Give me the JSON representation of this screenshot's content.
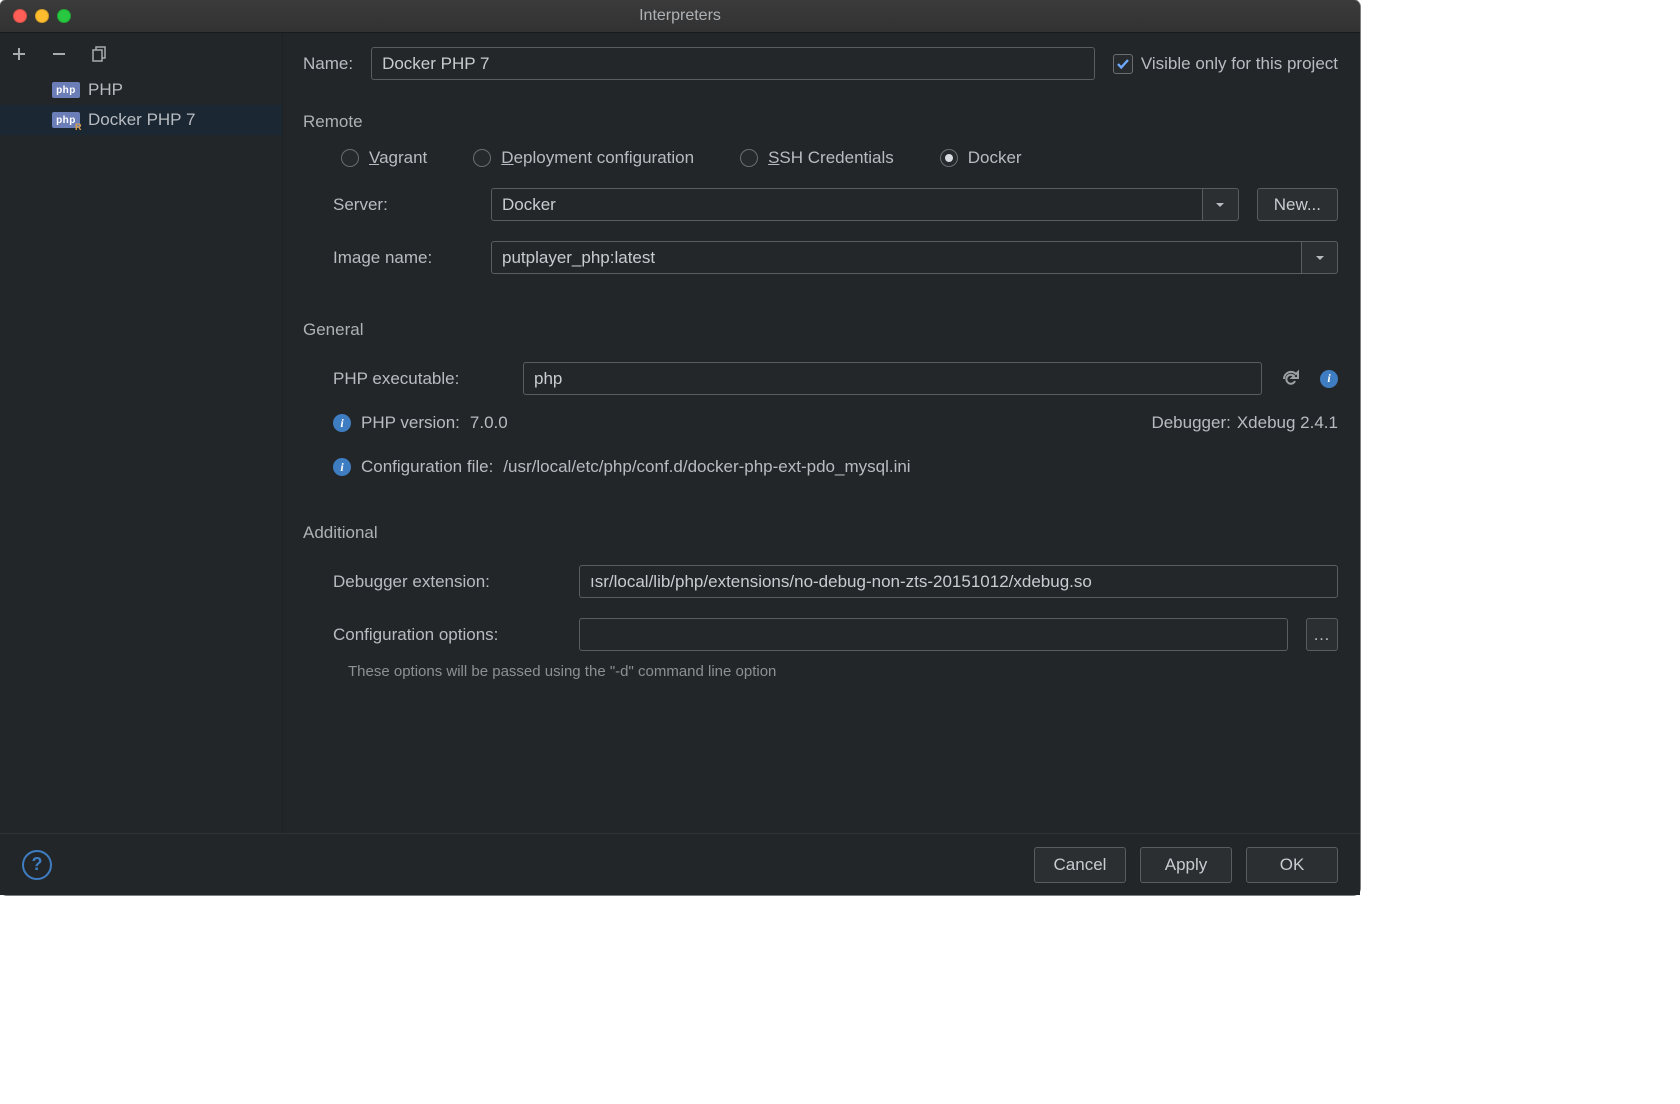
{
  "title": "Interpreters",
  "sidebar": {
    "items": [
      {
        "label": "PHP",
        "remote": false
      },
      {
        "label": "Docker PHP 7",
        "remote": true
      }
    ]
  },
  "form": {
    "name_label": "Name:",
    "name_value": "Docker PHP 7",
    "visible_only": "Visible only for this project",
    "remote_section": "Remote",
    "radios": {
      "vagrant": "Vagrant",
      "deployment": "Deployment configuration",
      "ssh": "SSH Credentials",
      "docker": "Docker"
    },
    "server_label": "Server:",
    "server_value": "Docker",
    "new_button": "New...",
    "image_label": "Image name:",
    "image_value": "putplayer_php:latest",
    "general_section": "General",
    "php_exe_label": "PHP executable:",
    "php_exe_value": "php",
    "php_version_label": "PHP version:",
    "php_version_value": "7.0.0",
    "debugger_label": "Debugger:",
    "debugger_value": "Xdebug 2.4.1",
    "config_file_label": "Configuration file:",
    "config_file_value": "/usr/local/etc/php/conf.d/docker-php-ext-pdo_mysql.ini",
    "additional_section": "Additional",
    "dbg_ext_label": "Debugger extension:",
    "dbg_ext_value": "ısr/local/lib/php/extensions/no-debug-non-zts-20151012/xdebug.so",
    "config_opts_label": "Configuration options:",
    "config_opts_value": "",
    "config_opts_hint": "These options will be passed using the \"-d\" command line option"
  },
  "footer": {
    "cancel": "Cancel",
    "apply": "Apply",
    "ok": "OK"
  }
}
